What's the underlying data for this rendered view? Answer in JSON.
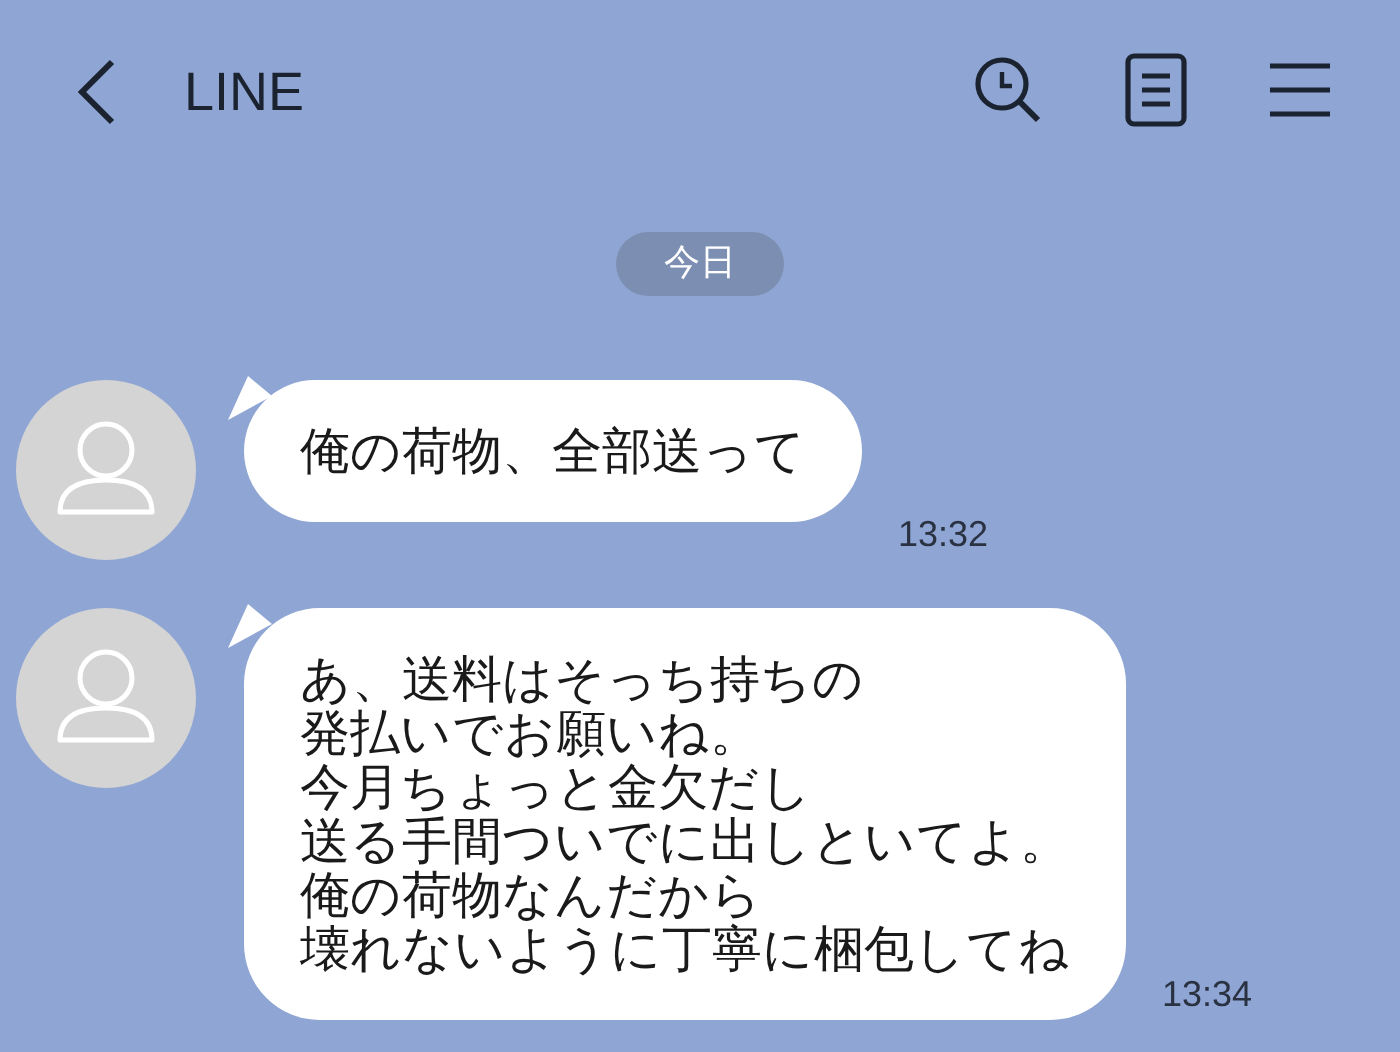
{
  "header": {
    "title": "LINE"
  },
  "date_label": "今日",
  "messages": [
    {
      "lines": [
        "俺の荷物、全部送って"
      ],
      "time": "13:32"
    },
    {
      "lines": [
        "あ、送料はそっち持ちの",
        "発払いでお願いね。",
        "今月ちょっと金欠だし",
        "送る手間ついでに出しといてよ。",
        "俺の荷物なんだから",
        "壊れないように丁寧に梱包してね"
      ],
      "time": "13:34"
    }
  ]
}
